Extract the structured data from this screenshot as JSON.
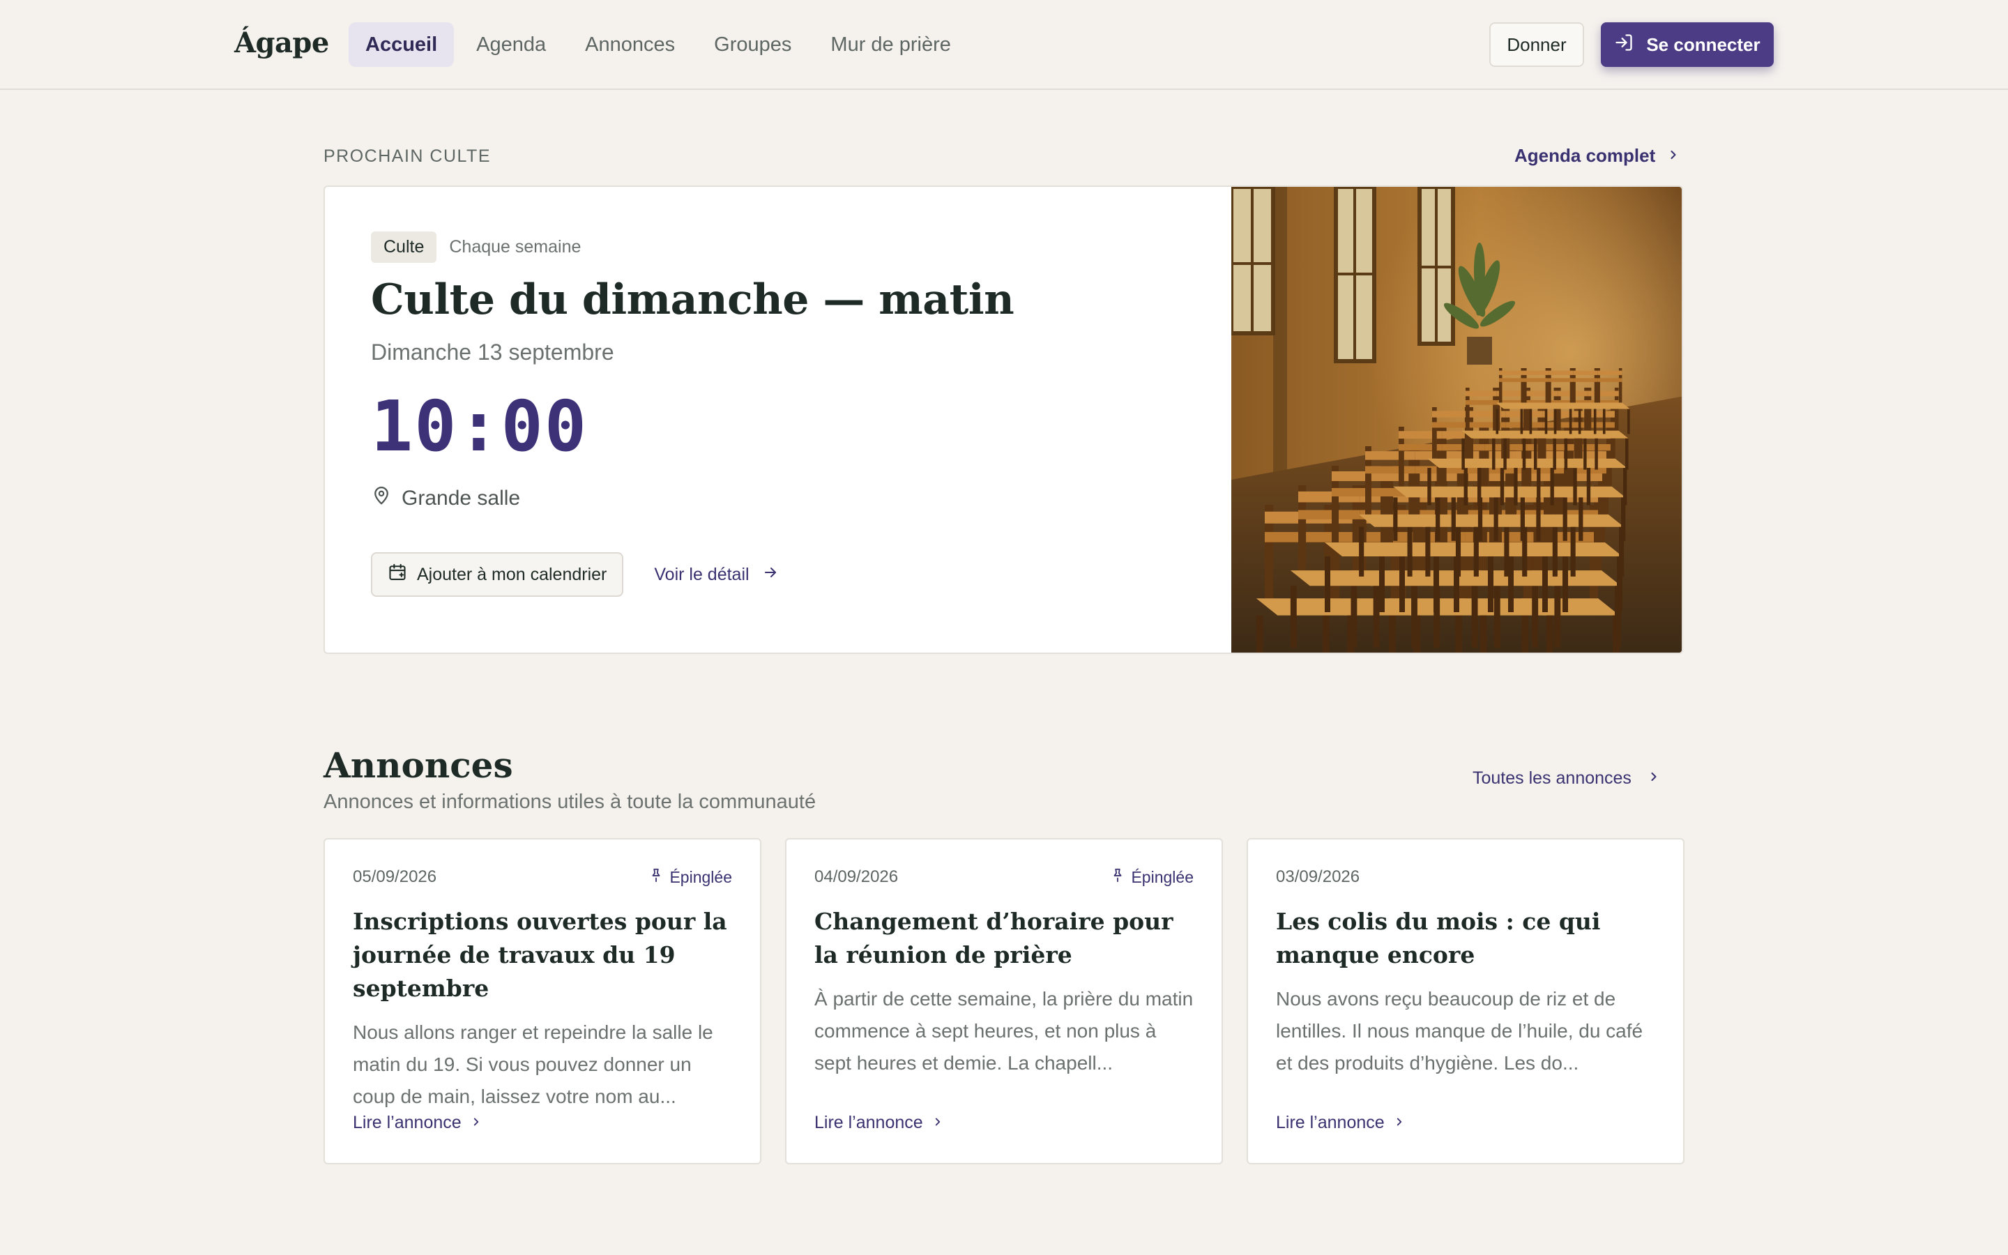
{
  "header": {
    "logo": "Ágape",
    "nav": [
      "Accueil",
      "Agenda",
      "Annonces",
      "Groupes",
      "Mur de prière"
    ],
    "active_nav": "Accueil",
    "donate_label": "Donner",
    "login_label": "Se connecter"
  },
  "next_service": {
    "section_label": "PROCHAIN CULTE",
    "agenda_link": "Agenda complet",
    "tag": "Culte",
    "recurrence": "Chaque semaine",
    "title": "Culte du dimanche — matin",
    "date": "Dimanche 13 septembre",
    "time": "10:00",
    "location": "Grande salle",
    "calendar_button": "Ajouter à mon calendrier",
    "detail_link": "Voir le détail"
  },
  "announcements": {
    "title": "Annonces",
    "subtitle": "Annonces et informations utiles à toute la communauté",
    "all_link": "Toutes les annonces",
    "read_label": "Lire l’annonce",
    "items": [
      {
        "date": "05/09/2026",
        "pinned": "Épinglée",
        "title": "Inscriptions ouvertes pour la journée de travaux du 19 septembre",
        "excerpt": "Nous allons ranger et repeindre la salle le matin du 19. Si vous pouvez donner un coup de main, laissez votre nom au..."
      },
      {
        "date": "04/09/2026",
        "pinned": "Épinglée",
        "title": "Changement d’horaire pour la réunion de prière",
        "excerpt": "À partir de cette semaine, la prière du matin commence à sept heures, et non plus à sept heures et demie. La chapell..."
      },
      {
        "date": "03/09/2026",
        "pinned": "",
        "title": "Les colis du mois : ce qui manque encore",
        "excerpt": "Nous avons reçu beaucoup de riz et de lentilles. Il nous manque de l’huile, du café et des produits d’hygiène. Les do..."
      }
    ]
  },
  "colors": {
    "background": "#f5f2ee",
    "accent": "#4b3c85",
    "text": "#1e2a26"
  }
}
